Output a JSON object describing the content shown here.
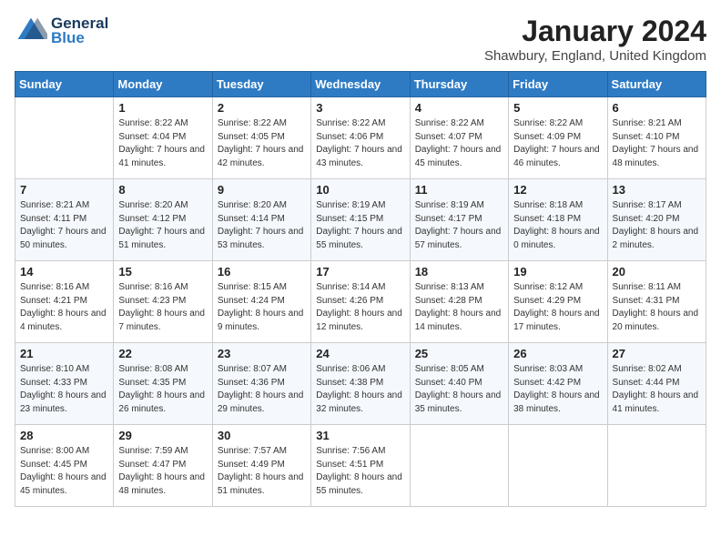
{
  "logo": {
    "line1": "General",
    "line2": "Blue"
  },
  "title": "January 2024",
  "subtitle": "Shawbury, England, United Kingdom",
  "days_of_week": [
    "Sunday",
    "Monday",
    "Tuesday",
    "Wednesday",
    "Thursday",
    "Friday",
    "Saturday"
  ],
  "weeks": [
    [
      {
        "day": "",
        "sunrise": "",
        "sunset": "",
        "daylight": ""
      },
      {
        "day": "1",
        "sunrise": "Sunrise: 8:22 AM",
        "sunset": "Sunset: 4:04 PM",
        "daylight": "Daylight: 7 hours and 41 minutes."
      },
      {
        "day": "2",
        "sunrise": "Sunrise: 8:22 AM",
        "sunset": "Sunset: 4:05 PM",
        "daylight": "Daylight: 7 hours and 42 minutes."
      },
      {
        "day": "3",
        "sunrise": "Sunrise: 8:22 AM",
        "sunset": "Sunset: 4:06 PM",
        "daylight": "Daylight: 7 hours and 43 minutes."
      },
      {
        "day": "4",
        "sunrise": "Sunrise: 8:22 AM",
        "sunset": "Sunset: 4:07 PM",
        "daylight": "Daylight: 7 hours and 45 minutes."
      },
      {
        "day": "5",
        "sunrise": "Sunrise: 8:22 AM",
        "sunset": "Sunset: 4:09 PM",
        "daylight": "Daylight: 7 hours and 46 minutes."
      },
      {
        "day": "6",
        "sunrise": "Sunrise: 8:21 AM",
        "sunset": "Sunset: 4:10 PM",
        "daylight": "Daylight: 7 hours and 48 minutes."
      }
    ],
    [
      {
        "day": "7",
        "sunrise": "Sunrise: 8:21 AM",
        "sunset": "Sunset: 4:11 PM",
        "daylight": "Daylight: 7 hours and 50 minutes."
      },
      {
        "day": "8",
        "sunrise": "Sunrise: 8:20 AM",
        "sunset": "Sunset: 4:12 PM",
        "daylight": "Daylight: 7 hours and 51 minutes."
      },
      {
        "day": "9",
        "sunrise": "Sunrise: 8:20 AM",
        "sunset": "Sunset: 4:14 PM",
        "daylight": "Daylight: 7 hours and 53 minutes."
      },
      {
        "day": "10",
        "sunrise": "Sunrise: 8:19 AM",
        "sunset": "Sunset: 4:15 PM",
        "daylight": "Daylight: 7 hours and 55 minutes."
      },
      {
        "day": "11",
        "sunrise": "Sunrise: 8:19 AM",
        "sunset": "Sunset: 4:17 PM",
        "daylight": "Daylight: 7 hours and 57 minutes."
      },
      {
        "day": "12",
        "sunrise": "Sunrise: 8:18 AM",
        "sunset": "Sunset: 4:18 PM",
        "daylight": "Daylight: 8 hours and 0 minutes."
      },
      {
        "day": "13",
        "sunrise": "Sunrise: 8:17 AM",
        "sunset": "Sunset: 4:20 PM",
        "daylight": "Daylight: 8 hours and 2 minutes."
      }
    ],
    [
      {
        "day": "14",
        "sunrise": "Sunrise: 8:16 AM",
        "sunset": "Sunset: 4:21 PM",
        "daylight": "Daylight: 8 hours and 4 minutes."
      },
      {
        "day": "15",
        "sunrise": "Sunrise: 8:16 AM",
        "sunset": "Sunset: 4:23 PM",
        "daylight": "Daylight: 8 hours and 7 minutes."
      },
      {
        "day": "16",
        "sunrise": "Sunrise: 8:15 AM",
        "sunset": "Sunset: 4:24 PM",
        "daylight": "Daylight: 8 hours and 9 minutes."
      },
      {
        "day": "17",
        "sunrise": "Sunrise: 8:14 AM",
        "sunset": "Sunset: 4:26 PM",
        "daylight": "Daylight: 8 hours and 12 minutes."
      },
      {
        "day": "18",
        "sunrise": "Sunrise: 8:13 AM",
        "sunset": "Sunset: 4:28 PM",
        "daylight": "Daylight: 8 hours and 14 minutes."
      },
      {
        "day": "19",
        "sunrise": "Sunrise: 8:12 AM",
        "sunset": "Sunset: 4:29 PM",
        "daylight": "Daylight: 8 hours and 17 minutes."
      },
      {
        "day": "20",
        "sunrise": "Sunrise: 8:11 AM",
        "sunset": "Sunset: 4:31 PM",
        "daylight": "Daylight: 8 hours and 20 minutes."
      }
    ],
    [
      {
        "day": "21",
        "sunrise": "Sunrise: 8:10 AM",
        "sunset": "Sunset: 4:33 PM",
        "daylight": "Daylight: 8 hours and 23 minutes."
      },
      {
        "day": "22",
        "sunrise": "Sunrise: 8:08 AM",
        "sunset": "Sunset: 4:35 PM",
        "daylight": "Daylight: 8 hours and 26 minutes."
      },
      {
        "day": "23",
        "sunrise": "Sunrise: 8:07 AM",
        "sunset": "Sunset: 4:36 PM",
        "daylight": "Daylight: 8 hours and 29 minutes."
      },
      {
        "day": "24",
        "sunrise": "Sunrise: 8:06 AM",
        "sunset": "Sunset: 4:38 PM",
        "daylight": "Daylight: 8 hours and 32 minutes."
      },
      {
        "day": "25",
        "sunrise": "Sunrise: 8:05 AM",
        "sunset": "Sunset: 4:40 PM",
        "daylight": "Daylight: 8 hours and 35 minutes."
      },
      {
        "day": "26",
        "sunrise": "Sunrise: 8:03 AM",
        "sunset": "Sunset: 4:42 PM",
        "daylight": "Daylight: 8 hours and 38 minutes."
      },
      {
        "day": "27",
        "sunrise": "Sunrise: 8:02 AM",
        "sunset": "Sunset: 4:44 PM",
        "daylight": "Daylight: 8 hours and 41 minutes."
      }
    ],
    [
      {
        "day": "28",
        "sunrise": "Sunrise: 8:00 AM",
        "sunset": "Sunset: 4:45 PM",
        "daylight": "Daylight: 8 hours and 45 minutes."
      },
      {
        "day": "29",
        "sunrise": "Sunrise: 7:59 AM",
        "sunset": "Sunset: 4:47 PM",
        "daylight": "Daylight: 8 hours and 48 minutes."
      },
      {
        "day": "30",
        "sunrise": "Sunrise: 7:57 AM",
        "sunset": "Sunset: 4:49 PM",
        "daylight": "Daylight: 8 hours and 51 minutes."
      },
      {
        "day": "31",
        "sunrise": "Sunrise: 7:56 AM",
        "sunset": "Sunset: 4:51 PM",
        "daylight": "Daylight: 8 hours and 55 minutes."
      },
      {
        "day": "",
        "sunrise": "",
        "sunset": "",
        "daylight": ""
      },
      {
        "day": "",
        "sunrise": "",
        "sunset": "",
        "daylight": ""
      },
      {
        "day": "",
        "sunrise": "",
        "sunset": "",
        "daylight": ""
      }
    ]
  ]
}
